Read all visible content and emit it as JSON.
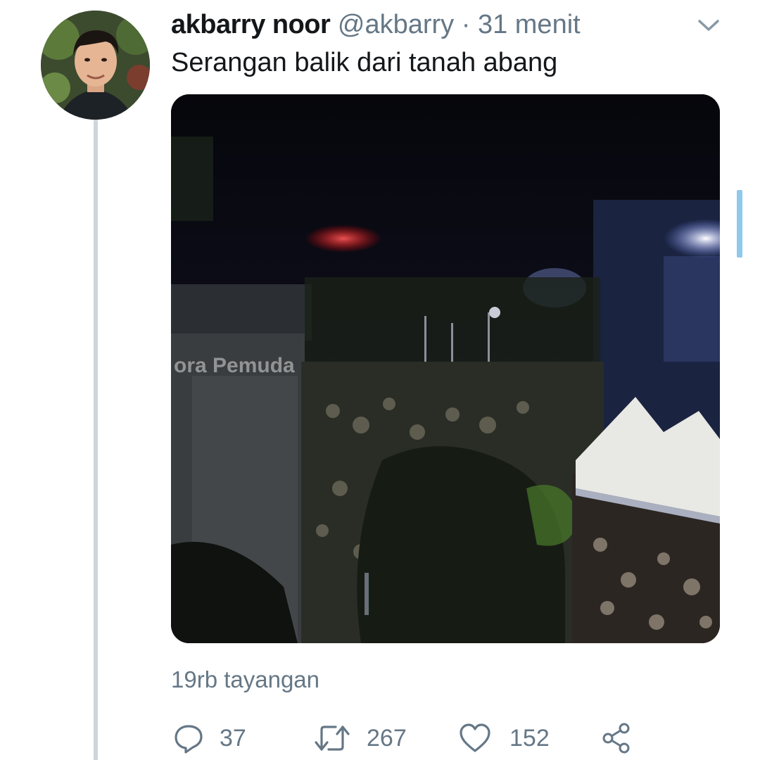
{
  "tweet": {
    "author_name": "akbarry noor",
    "author_handle": "@akbarry",
    "separator": "·",
    "time": "31 menit",
    "text": "Serangan balik dari tanah abang",
    "views": "19rb tayangan"
  },
  "actions": {
    "reply_count": "37",
    "retweet_count": "267",
    "like_count": "152"
  },
  "icons": {
    "menu": "chevron-down-icon",
    "reply": "reply-icon",
    "retweet": "retweet-icon",
    "like": "heart-icon",
    "share": "share-icon"
  },
  "colors": {
    "text": "#14171a",
    "secondary": "#657786",
    "thread_line": "#ccd6dd",
    "accent": "#1da1f2"
  }
}
